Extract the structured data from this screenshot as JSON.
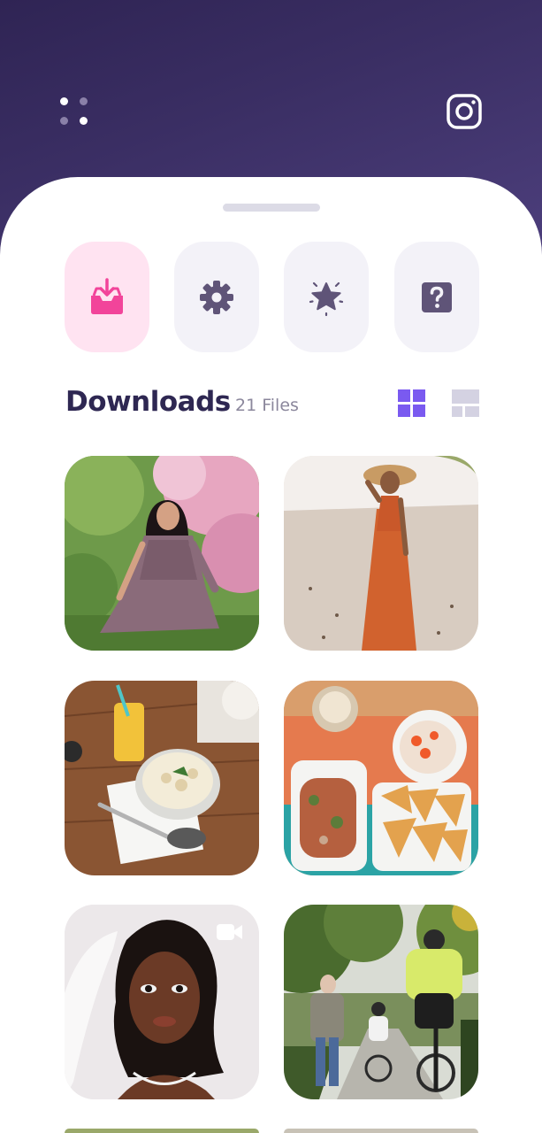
{
  "header": {
    "menu_icon": "menu-dots-icon",
    "social_icon": "instagram-icon"
  },
  "actions": [
    {
      "name": "downloads",
      "icon": "inbox-download-icon",
      "active": true
    },
    {
      "name": "settings",
      "icon": "gear-icon",
      "active": false
    },
    {
      "name": "favorites",
      "icon": "star-icon",
      "active": false
    },
    {
      "name": "help",
      "icon": "question-icon",
      "active": false
    }
  ],
  "downloads": {
    "title": "Downloads",
    "count_label": "21 Files",
    "view_modes": [
      "grid-view-icon",
      "list-view-icon"
    ],
    "active_view": "grid"
  },
  "gallery": [
    {
      "id": 1,
      "type": "photo",
      "subject": "woman-in-blossom-garden"
    },
    {
      "id": 2,
      "type": "photo",
      "subject": "woman-orange-dress-beach"
    },
    {
      "id": 3,
      "type": "photo",
      "subject": "soup-bowl-and-juice"
    },
    {
      "id": 4,
      "type": "photo",
      "subject": "avocado-toast-and-chips"
    },
    {
      "id": 5,
      "type": "video",
      "subject": "bride-portrait"
    },
    {
      "id": 6,
      "type": "photo",
      "subject": "people-on-park-path"
    }
  ],
  "colors": {
    "header_gradient_start": "#2f2454",
    "header_gradient_end": "#4d3f7d",
    "accent_pink": "#f2449a",
    "active_tile_bg": "#ffe3f1",
    "tile_bg": "#f3f2f8",
    "icon_purple": "#5f5478",
    "grid_icon": "#7a5af0",
    "title_text": "#2e2752"
  }
}
